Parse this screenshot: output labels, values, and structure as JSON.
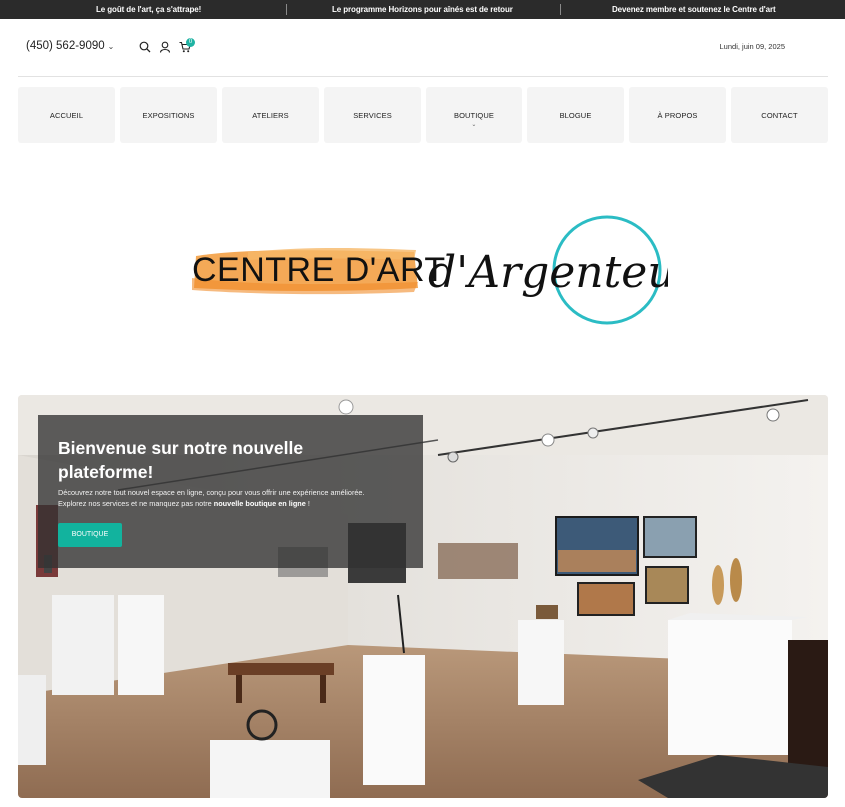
{
  "announcements": [
    "Le goût de l'art, ça s'attrape!",
    "Le programme Horizons pour aînés est de retour",
    "Devenez membre et soutenez le Centre d'art"
  ],
  "header": {
    "phone": "(450) 562-9090",
    "cart_count": "0",
    "date": "Lundi, juin 09, 2025"
  },
  "nav": {
    "items": [
      "ACCUEIL",
      "EXPOSITIONS",
      "ATELIERS",
      "SERVICES",
      "BOUTIQUE",
      "BLOGUE",
      "À PROPOS",
      "CONTACT"
    ]
  },
  "logo": {
    "text_main": "CENTRE D'ART",
    "text_script": "d'Argenteuil",
    "brush_color": "#f29a3a",
    "circle_color": "#2bbcc4"
  },
  "hero": {
    "title": "Bienvenue sur notre nouvelle plateforme!",
    "text_before": "Découvrez notre tout nouvel espace en ligne, conçu pour vous offrir une expérience améliorée. Explorez nos services et ne manquez pas notre ",
    "text_bold": "nouvelle boutique en ligne",
    "text_after": " !",
    "button": "BOUTIQUE"
  },
  "colors": {
    "accent": "#12b39e",
    "topbar": "#2b2b2b"
  }
}
